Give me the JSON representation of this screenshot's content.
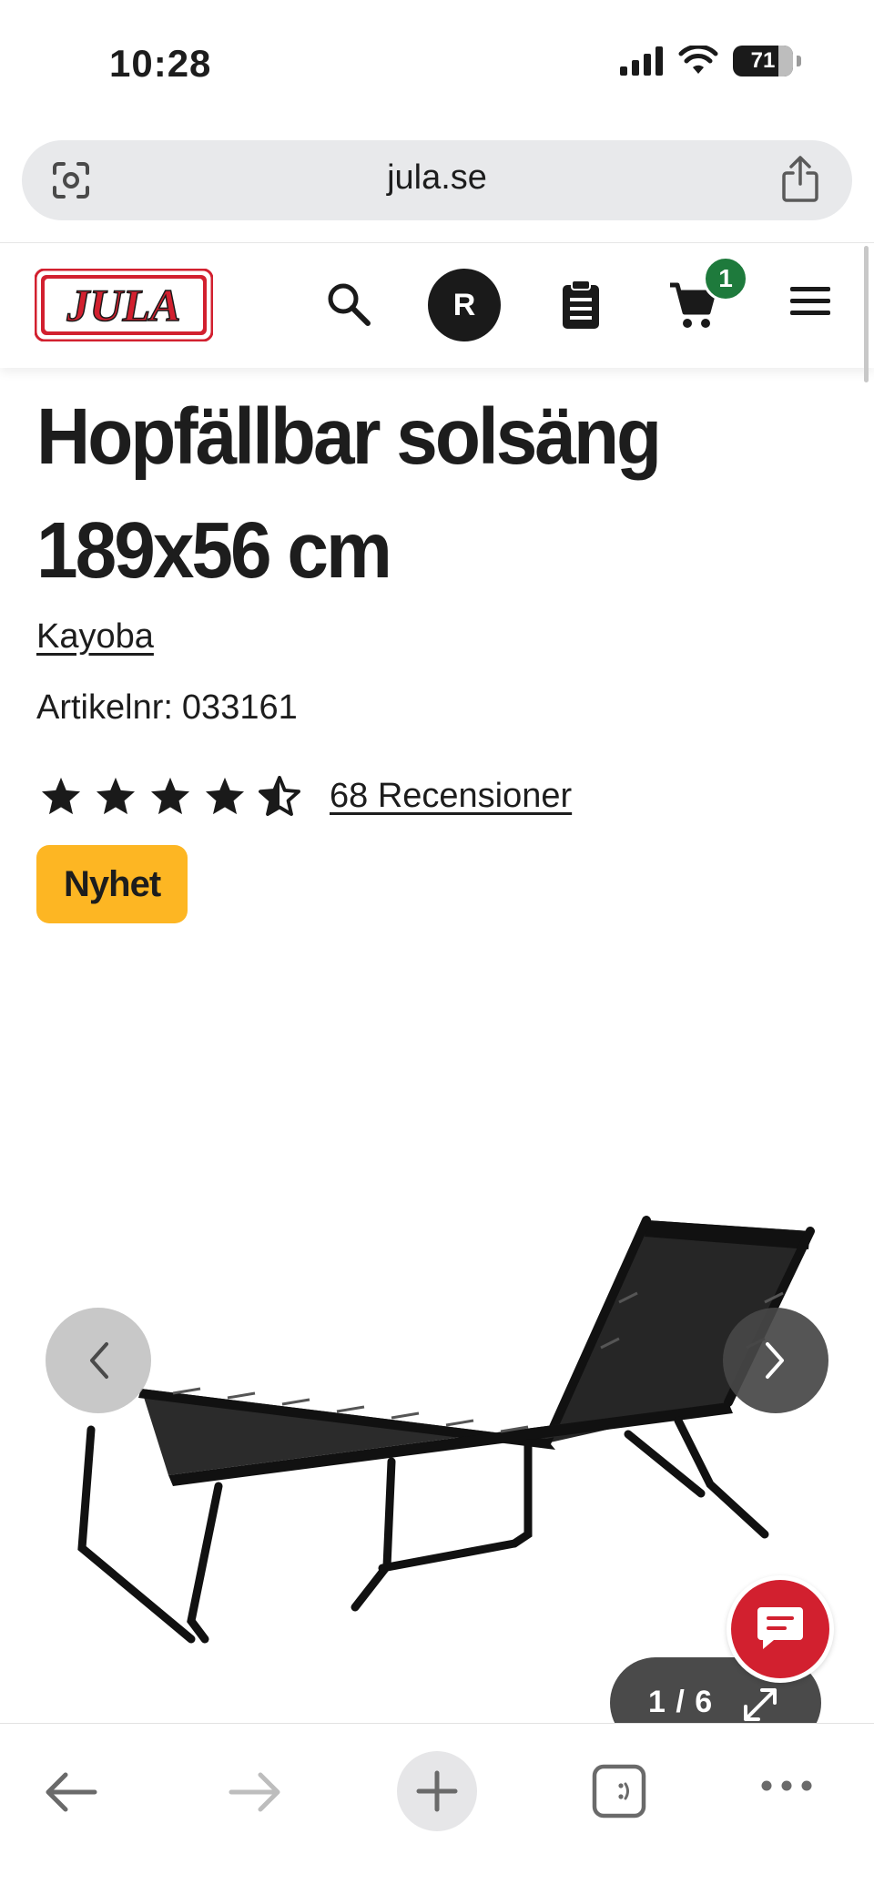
{
  "status_bar": {
    "time": "10:28",
    "battery": "71",
    "icons": [
      "signal-icon",
      "wifi-icon",
      "battery-icon"
    ]
  },
  "browser": {
    "url": "jula.se",
    "bottom_bar": {
      "icons": [
        "back-arrow-icon",
        "forward-arrow-icon",
        "plus-icon",
        "tabs-icon",
        "more-icon"
      ]
    }
  },
  "header": {
    "logo_text": "JULA",
    "avatar_initial": "R",
    "cart_count": "1",
    "icons": [
      "search-icon",
      "shopping-list-icon",
      "cart-icon",
      "hamburger-menu-icon"
    ]
  },
  "product": {
    "title": "Hopfällbar solsäng 189x56 cm",
    "brand": "Kayoba",
    "sku_label": "Artikelnr:",
    "sku_value": "033161",
    "rating": 4.5,
    "rating_max": 5,
    "reviews_label": "68 Recensioner",
    "badge": "Nyhet"
  },
  "gallery": {
    "counter": "1 / 6",
    "image_alt": "black folding sun lounger",
    "icons": [
      "chevron-left-icon",
      "chevron-right-icon",
      "expand-icon"
    ]
  },
  "chat": {
    "icon": "chat-bubble-icon"
  },
  "colors": {
    "brand_red": "#d2202f",
    "badge_yellow": "#fdb623",
    "cart_badge_green": "#1e7a3c",
    "text": "#1d1d1d"
  }
}
